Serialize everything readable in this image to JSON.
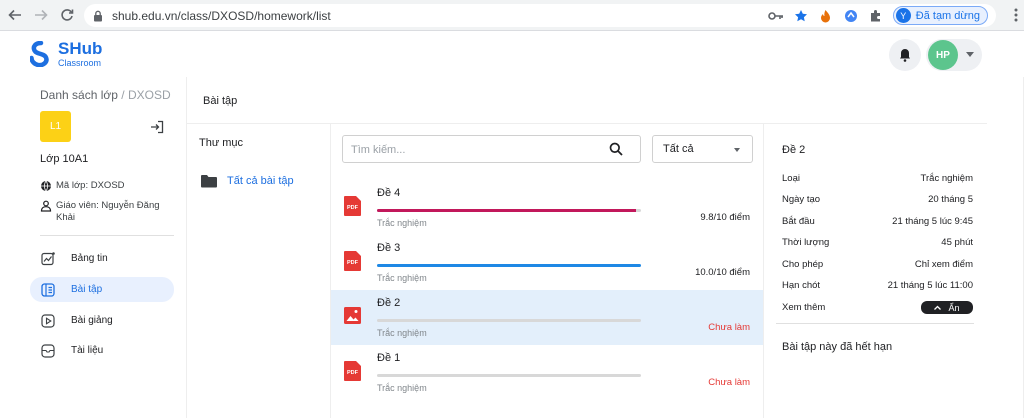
{
  "browser": {
    "url": "shub.edu.vn/class/DXOSD/homework/list",
    "profile_initial": "Y",
    "profile_status": "Đã tạm dừng"
  },
  "app": {
    "brand": "SHub",
    "brand_sub": "Classroom",
    "user_initials": "HP",
    "accent": "#1d6fe0"
  },
  "sidebar": {
    "breadcrumb_root": "Danh sách lớp",
    "breadcrumb_sep": " / ",
    "breadcrumb_current": "DXOSD",
    "class_badge": "L1",
    "class_name": "Lớp 10A1",
    "class_code": "Mã lớp: DXOSD",
    "teacher": "Giáo viên: Nguyễn Đăng Khải",
    "menu": [
      {
        "label": "Bảng tin",
        "icon": "chart-icon"
      },
      {
        "label": "Bài tập",
        "icon": "assignment-icon",
        "active": true
      },
      {
        "label": "Bài giảng",
        "icon": "play-icon"
      },
      {
        "label": "Tài liệu",
        "icon": "document-icon"
      }
    ]
  },
  "main": {
    "title": "Bài tập",
    "folders_heading": "Thư mục",
    "folder_all": "Tất cả bài tập",
    "search_placeholder": "Tìm kiếm...",
    "filter_value": "Tất cả",
    "homework": [
      {
        "title": "Đề 4",
        "type": "Trắc nghiệm",
        "score": "9.8/10 điểm",
        "progress": 0.98,
        "bar_color": "#c2185b",
        "icon": "pdf-icon",
        "status": "done"
      },
      {
        "title": "Đề 3",
        "type": "Trắc nghiệm",
        "score": "10.0/10 điểm",
        "progress": 1.0,
        "bar_color": "#1e88e5",
        "icon": "pdf-icon",
        "status": "done"
      },
      {
        "title": "Đề 2",
        "type": "Trắc nghiệm",
        "score": "Chưa làm",
        "progress": 0,
        "bar_color": "#d8d8d8",
        "icon": "image-icon",
        "status": "todo",
        "selected": true
      },
      {
        "title": "Đề 1",
        "type": "Trắc nghiệm",
        "score": "Chưa làm",
        "progress": 0,
        "bar_color": "#d8d8d8",
        "icon": "pdf-icon",
        "status": "todo"
      }
    ]
  },
  "detail": {
    "title": "Đề 2",
    "rows": [
      {
        "key": "Loại",
        "value": "Trắc nghiệm"
      },
      {
        "key": "Ngày tạo",
        "value": "20 tháng 5"
      },
      {
        "key": "Bắt đầu",
        "value": "21 tháng 5 lúc 9:45"
      },
      {
        "key": "Thời lượng",
        "value": "45 phút"
      },
      {
        "key": "Cho phép",
        "value": "Chỉ xem điểm"
      },
      {
        "key": "Hạn chót",
        "value": "21 tháng 5 lúc 11:00"
      }
    ],
    "see_more": "Xem thêm",
    "toggle_label": "Ẩn",
    "expired": "Bài tập này đã hết hạn"
  }
}
